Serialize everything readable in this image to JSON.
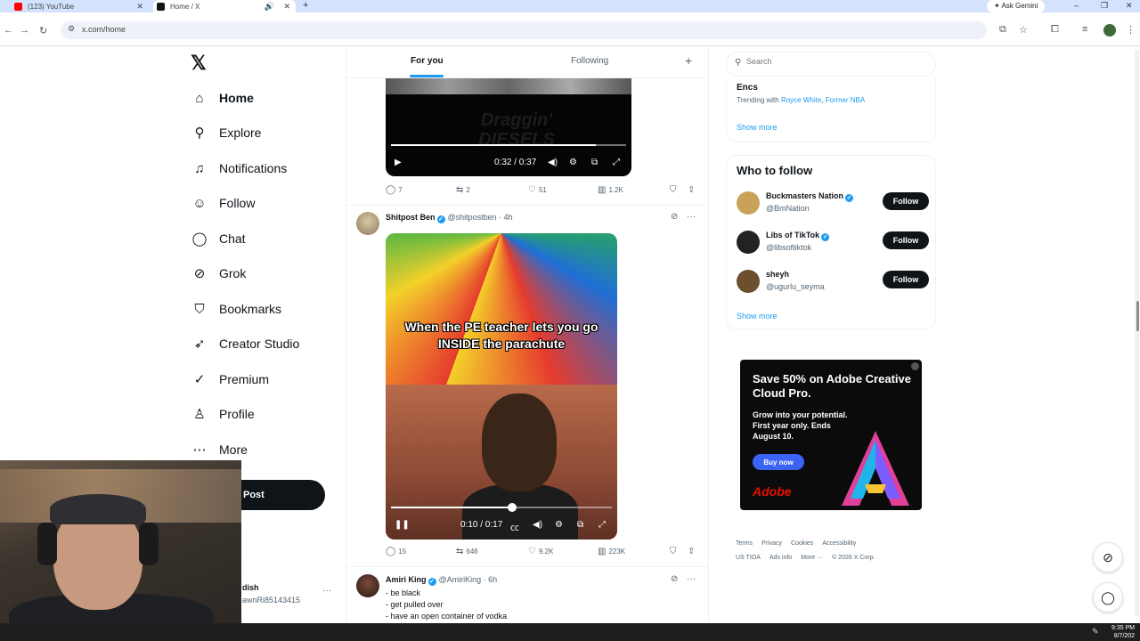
{
  "browser": {
    "tabs": [
      {
        "title": "(123) YouTube",
        "favicon_color": "#ff0000"
      },
      {
        "title": "Home / X",
        "favicon_color": "#0f1419"
      }
    ],
    "gemini_label": "Ask Gemini",
    "url": "x.com/home"
  },
  "sidebar": {
    "logo": "𝕏",
    "items": [
      {
        "label": "Home",
        "icon": "home-icon",
        "glyph": "⌂"
      },
      {
        "label": "Explore",
        "icon": "search-icon",
        "glyph": "⚲"
      },
      {
        "label": "Notifications",
        "icon": "bell-icon",
        "glyph": "♫"
      },
      {
        "label": "Follow",
        "icon": "person-add-icon",
        "glyph": "☺"
      },
      {
        "label": "Chat",
        "icon": "chat-icon",
        "glyph": "◯"
      },
      {
        "label": "Grok",
        "icon": "grok-icon",
        "glyph": "⊘"
      },
      {
        "label": "Bookmarks",
        "icon": "bookmark-icon",
        "glyph": "⛉"
      },
      {
        "label": "Creator Studio",
        "icon": "rocket-icon",
        "glyph": "➶"
      },
      {
        "label": "Premium",
        "icon": "verified-icon",
        "glyph": "✓"
      },
      {
        "label": "Profile",
        "icon": "person-icon",
        "glyph": "♙"
      },
      {
        "label": "More",
        "icon": "more-circle-icon",
        "glyph": "⋯"
      }
    ],
    "post_label": "Post",
    "account": {
      "name": "dish",
      "handle": "awnRi85143415"
    }
  },
  "feed": {
    "tabs": {
      "for_you": "For you",
      "following": "Following",
      "add": "+"
    },
    "tweet1": {
      "video": {
        "watermark": "Draggin' DIESELS",
        "time": "0:32 / 0:37",
        "progress": 0.87
      },
      "stats": {
        "replies": "7",
        "reposts": "2",
        "likes": "51",
        "views": "1.2K"
      }
    },
    "tweet2": {
      "name": "Shitpost Ben",
      "handle": "@shitpostben · 4h",
      "video": {
        "caption": "When the PE teacher lets you go INSIDE the parachute",
        "time": "0:10 / 0:17",
        "progress": 0.55
      },
      "stats": {
        "replies": "15",
        "reposts": "646",
        "likes": "9.2K",
        "views": "223K"
      }
    },
    "tweet3": {
      "name": "Amiri King",
      "handle": "@AmiriKing · 6h",
      "lines": [
        "- be black",
        "- get pulled over",
        "- have an open container of vodka"
      ]
    }
  },
  "right": {
    "search_placeholder": "Search",
    "trend": {
      "name": "Encs",
      "prefix": "Trending with ",
      "link1": "Royce White",
      "link2": "Former NBA"
    },
    "show_more": "Show more",
    "who_to_follow": {
      "title": "Who to follow",
      "button": "Follow",
      "accounts": [
        {
          "name": "Buckmasters Nation",
          "handle": "@BmNation",
          "avatar_color": "#c9a25a"
        },
        {
          "name": "Libs of TikTok",
          "handle": "@libsoftiktok",
          "avatar_color": "#222222"
        },
        {
          "name": "sheyh",
          "handle": "@ugurlu_seyma",
          "avatar_color": "#6b4f2e"
        }
      ]
    },
    "ad": {
      "headline": "Save 50% on Adobe Creative Cloud Pro.",
      "body": "Grow into your potential. First year only. Ends August 10.",
      "cta": "Buy now",
      "brand": "Adobe"
    },
    "footer": {
      "line1": [
        "Terms",
        "Privacy",
        "Cookies",
        "Accessibility"
      ],
      "line2": [
        "US TIOA",
        "Ads info",
        "More ···",
        "© 2026 X Corp."
      ]
    }
  },
  "taskbar": {
    "time": "9:35 PM",
    "date": "8/7/202"
  }
}
